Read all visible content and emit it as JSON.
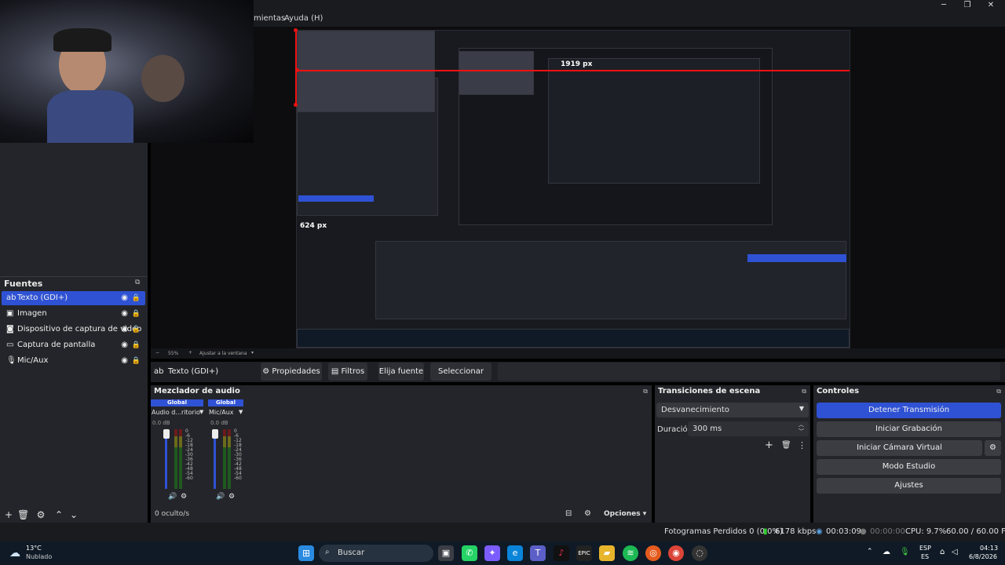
{
  "window": {
    "menu_partial": "mientas",
    "menu_help": "Ayuda (H)",
    "min": "─",
    "max": "❐",
    "close": "✕"
  },
  "preview": {
    "width_label": "1919 px",
    "height_label": "624 px",
    "zoom_percent": "55%",
    "fit_label": "Ajustar a la ventana"
  },
  "sources": {
    "title": "Fuentes",
    "items": [
      {
        "label": "Texto (GDI+)",
        "icon": "text-icon",
        "selected": true
      },
      {
        "label": "Imagen",
        "icon": "image-icon",
        "selected": false
      },
      {
        "label": "Dispositivo de captura de video",
        "icon": "camera-icon",
        "selected": false
      },
      {
        "label": "Captura de pantalla",
        "icon": "monitor-icon",
        "selected": false
      },
      {
        "label": "Mic/Aux",
        "icon": "mic-icon",
        "selected": false
      }
    ]
  },
  "source_toolbar": {
    "selected": "Texto (GDI+)",
    "properties": "Propiedades",
    "filters": "Filtros",
    "choose_font": "Elija fuente",
    "select_color": "Seleccionar color"
  },
  "mixer": {
    "title": "Mezclador de audio",
    "channels": [
      {
        "header": "Global",
        "name": "Audio d...ritorio",
        "db": "0.0 dB"
      },
      {
        "header": "Global",
        "name": "Mic/Aux",
        "db": "0.0 dB"
      }
    ],
    "scale": [
      "0",
      "-6",
      "-12",
      "-18",
      "-24",
      "-30",
      "-36",
      "-42",
      "-48",
      "-54",
      "-60"
    ],
    "hidden": "0 oculto/s",
    "options": "Opciones"
  },
  "transitions": {
    "title": "Transiciones de escena",
    "selected": "Desvanecimiento",
    "duration_label": "Duración",
    "duration_value": "300 ms"
  },
  "controls": {
    "title": "Controles",
    "stop_stream": "Detener Transmisión",
    "start_recording": "Iniciar Grabación",
    "virtual_cam": "Iniciar Cámara Virtual",
    "studio_mode": "Modo Estudio",
    "settings": "Ajustes"
  },
  "status": {
    "dropped_frames": "Fotogramas Perdidos 0 (0.0%)",
    "bitrate": "6178 kbps",
    "stream_time": "00:03:09",
    "rec_time": "00:00:00",
    "cpu": "CPU: 9.7%",
    "fps": "60.00 / 60.00 FPS"
  },
  "taskbar": {
    "weather_temp": "13°C",
    "weather_desc": "Nublado",
    "search": "Buscar",
    "lang_top": "ESP",
    "lang_bottom": "ES",
    "time": "04:13",
    "date": "6/8/2026"
  },
  "colors": {
    "accent": "#2f52d4",
    "red_guide": "#e11111",
    "panel": "#24252a"
  }
}
